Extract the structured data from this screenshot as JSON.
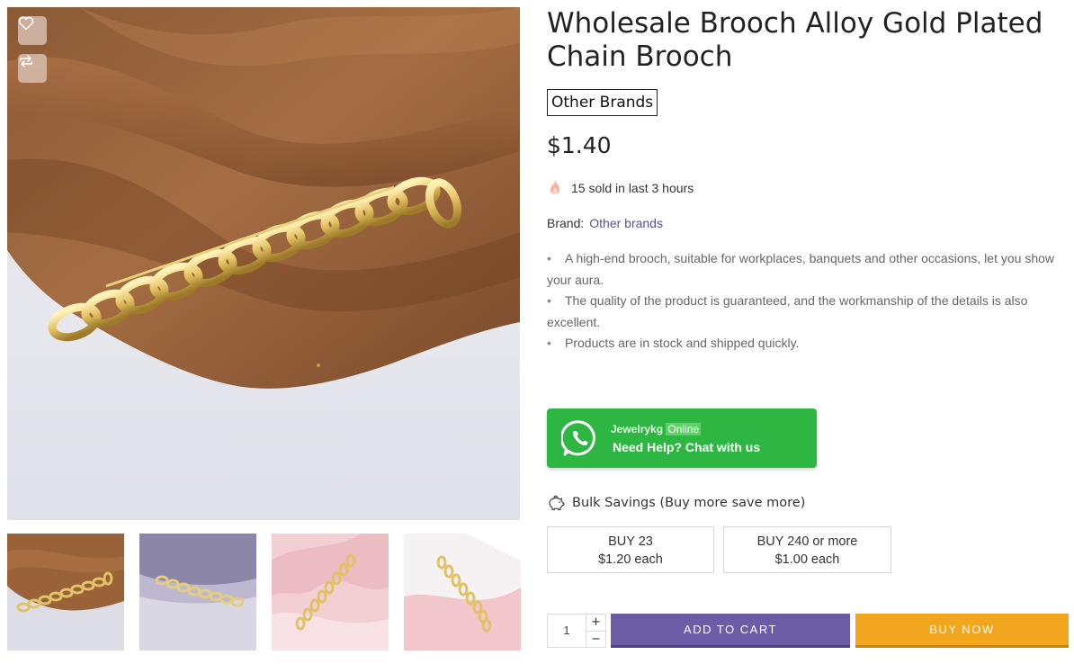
{
  "product": {
    "title": "Wholesale Brooch Alloy Gold Plated Chain Brooch",
    "brand_badge": "Other Brands",
    "price": "$1.40",
    "sold_text": "15 sold in last 3 hours",
    "brand_label": "Brand:",
    "brand_value": "Other brands",
    "features": [
      "A high-end brooch, suitable for workplaces, banquets and other occasions, let you show your aura.",
      "The quality of the product is guaranteed, and the workmanship of the details is also excellent.",
      "Products are in stock and shipped quickly."
    ]
  },
  "whatsapp": {
    "name": "Jewelrykg",
    "status": "Online",
    "help": "Need Help? Chat with us"
  },
  "bulk": {
    "heading": "Bulk Savings (Buy more save more)",
    "tiers": [
      {
        "qty_label": "BUY 23",
        "price_label": "$1.20 each"
      },
      {
        "qty_label": "BUY 240 or more",
        "price_label": "$1.00 each"
      }
    ]
  },
  "cart": {
    "quantity": "1",
    "plus": "+",
    "minus": "−",
    "add_to_cart": "ADD TO CART",
    "buy_now": "BUY NOW"
  },
  "icons": {
    "wishlist": "heart-icon",
    "compare": "compare-icon",
    "sold": "flame-icon",
    "bulk": "piggy-bank-icon",
    "chat": "whatsapp-icon"
  },
  "colors": {
    "add_to_cart": "#6b5ca5",
    "buy_now": "#f2a61e",
    "whatsapp": "#2db742",
    "brand_link": "#5b4f9a"
  }
}
